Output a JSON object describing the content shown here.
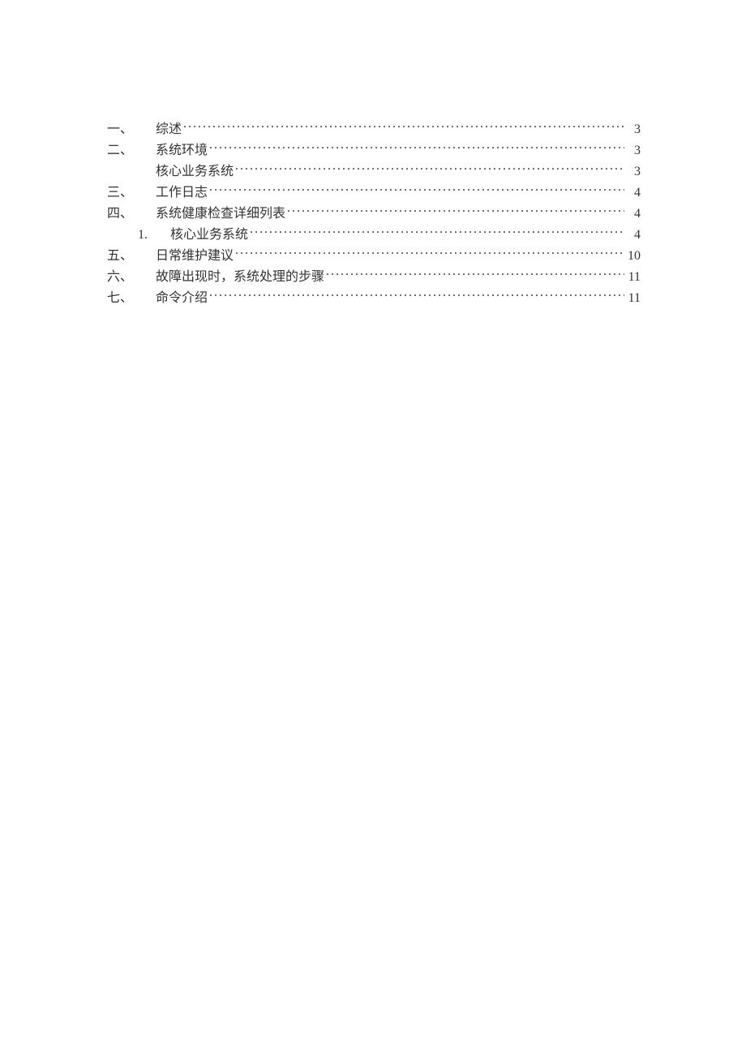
{
  "toc": [
    {
      "number": "一、",
      "title": "综述",
      "page": "3",
      "level": 0
    },
    {
      "number": "二、",
      "title": "系统环境",
      "page": "3",
      "level": 0
    },
    {
      "number": "",
      "title": "核心业务系统",
      "page": "3",
      "level": 1
    },
    {
      "number": "三、",
      "title": "工作日志",
      "page": "4",
      "level": 0
    },
    {
      "number": "四、",
      "title": "系统健康检查详细列表",
      "page": "4",
      "level": 0
    },
    {
      "number": "1.",
      "title": "核心业务系统",
      "page": "4",
      "level": 2
    },
    {
      "number": "五、",
      "title": "日常维护建议",
      "page": "10",
      "level": 0
    },
    {
      "number": "六、",
      "title": "故障出现时，系统处理的步骤",
      "page": "11",
      "level": 0
    },
    {
      "number": "七、",
      "title": "命令介绍",
      "page": "11",
      "level": 0
    }
  ]
}
